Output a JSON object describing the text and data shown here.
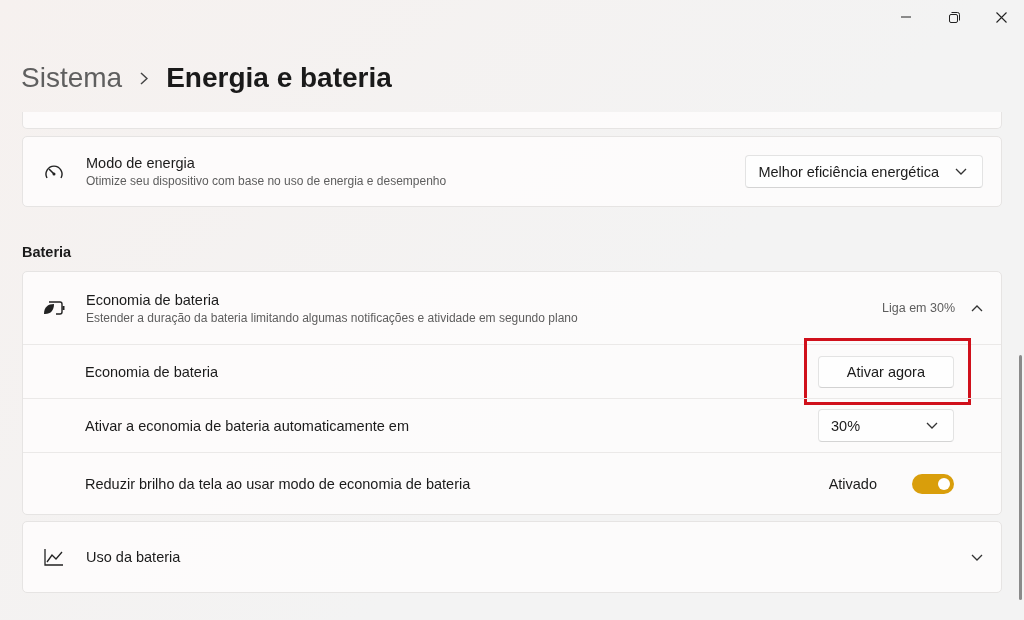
{
  "breadcrumb": {
    "parent": "Sistema",
    "current": "Energia e bateria"
  },
  "power_mode": {
    "title": "Modo de energia",
    "description": "Otimize seu dispositivo com base no uso de energia e desempenho",
    "dropdown": {
      "value": "Melhor eficiência energética"
    }
  },
  "section_label": "Bateria",
  "battery_saver": {
    "title": "Economia de bateria",
    "description": "Estender a duração da bateria limitando algumas notificações e atividade em segundo plano",
    "status": "Liga em 30%",
    "expanded": true,
    "rows": [
      {
        "kind": "button",
        "label": "Economia de bateria",
        "button": "Ativar agora",
        "highlighted": true
      },
      {
        "kind": "dropdown",
        "label": "Ativar a economia de bateria automaticamente em",
        "value": "30%"
      },
      {
        "kind": "toggle",
        "label": "Reduzir brilho da tela ao usar modo de economia de bateria",
        "state_text": "Ativado",
        "on": true
      }
    ]
  },
  "battery_usage": {
    "title": "Uso da bateria",
    "expanded": false
  }
}
